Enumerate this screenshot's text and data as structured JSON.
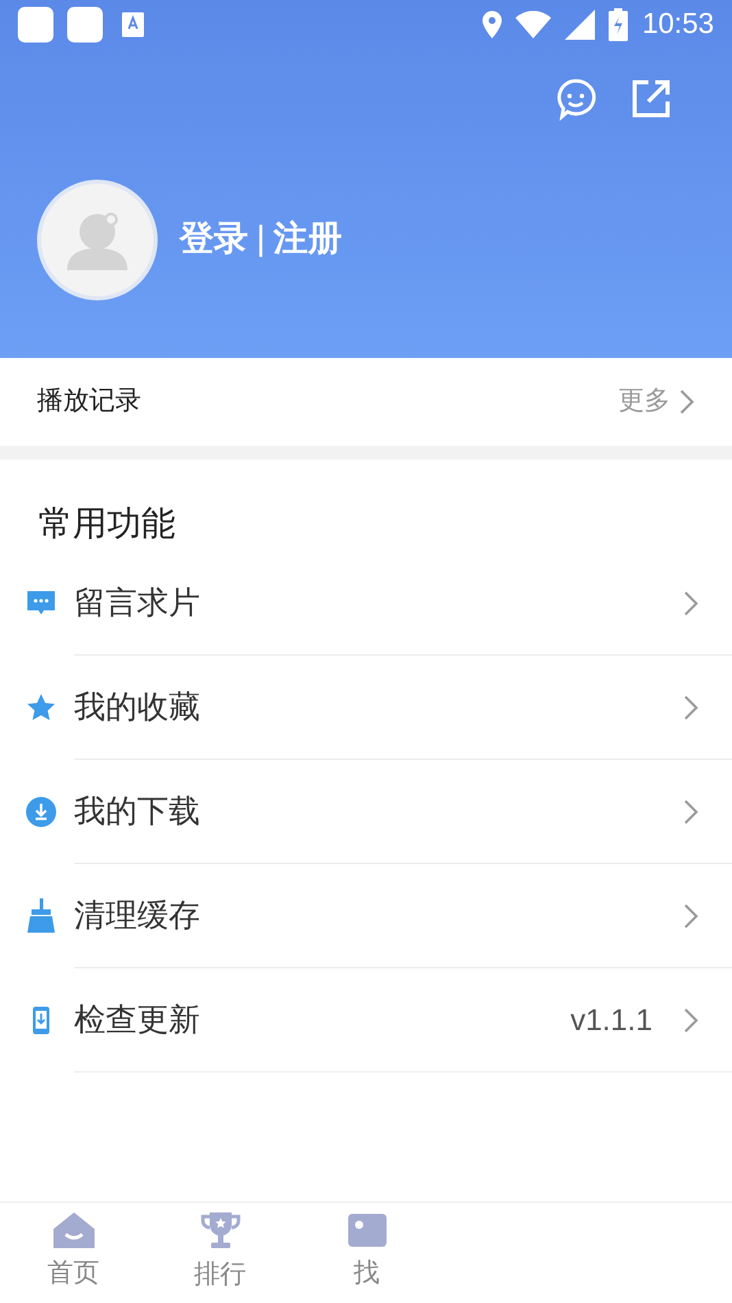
{
  "status_bar": {
    "time": "10:53"
  },
  "profile": {
    "login_text": "登录",
    "separator": "|",
    "register_text": "注册"
  },
  "history": {
    "title": "播放记录",
    "more": "更多"
  },
  "section": {
    "title": "常用功能"
  },
  "menu": [
    {
      "label": "留言求片"
    },
    {
      "label": "我的收藏"
    },
    {
      "label": "我的下载"
    },
    {
      "label": "清理缓存"
    },
    {
      "label": "检查更新",
      "value": "v1.1.1"
    }
  ],
  "bottom_nav": [
    {
      "label": "首页"
    },
    {
      "label": "排行"
    },
    {
      "label": "找"
    }
  ]
}
